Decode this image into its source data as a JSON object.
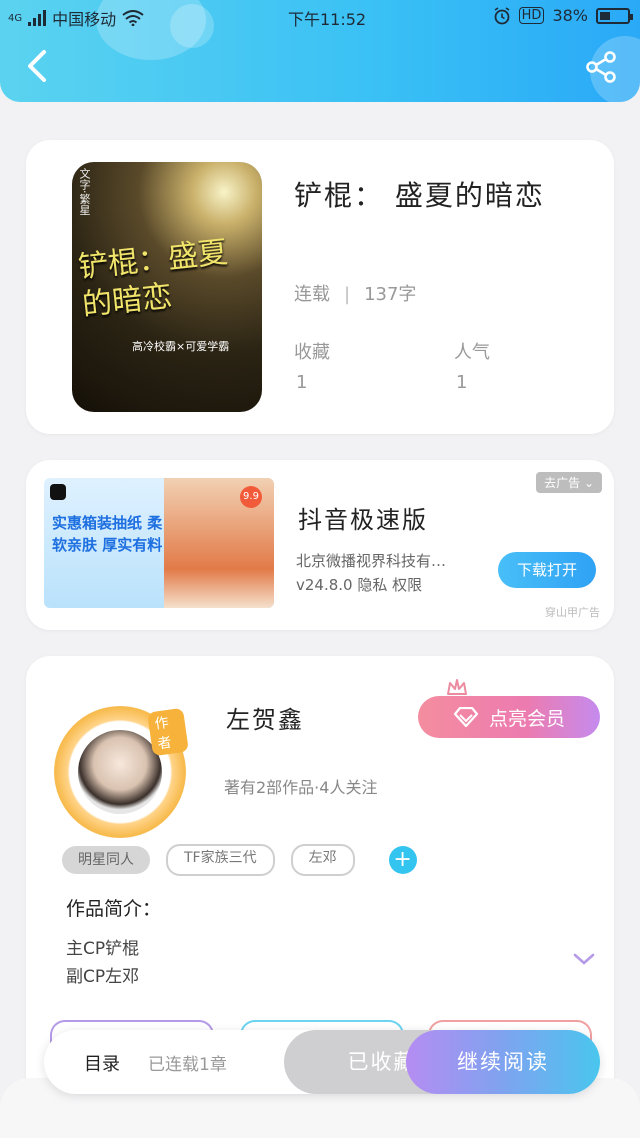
{
  "status_bar": {
    "network": "4G",
    "carrier": "中国移动",
    "time": "下午11:52",
    "volte": "HD",
    "battery": "38%"
  },
  "icons": {
    "back": "back-chevron-icon",
    "share": "share-icon",
    "wifi": "wifi-icon",
    "alarm": "alarm-icon",
    "expand": "chevron-down-icon",
    "diamond": "diamond-icon",
    "crown": "crown-icon",
    "add": "plus-icon"
  },
  "book": {
    "cover_title": "铲棍：盛夏的暗恋",
    "cover_subtitle": "高冷校霸×可爱学霸",
    "cover_side": "文字·繁星",
    "title": "铲棍： 盛夏的暗恋",
    "status": "连载",
    "word_count": "137字",
    "favorites_label": "收藏",
    "favorites_value": "1",
    "popularity_label": "人气",
    "popularity_value": "1"
  },
  "ad": {
    "image_banner": "实惠箱装抽纸 柔软亲肤 厚实有料",
    "image_badge": "9.9",
    "title": "抖音极速版",
    "company": "北京微播视界科技有…",
    "version_line": "v24.8.0 隐私 权限",
    "close_label": "去广告",
    "download_label": "下载打开",
    "source": "穿山甲广告"
  },
  "author": {
    "badge": "作者",
    "name": "左贺鑫",
    "stats": "著有2部作品·4人关注",
    "vip_button": "点亮会员",
    "tags": [
      "明星同人",
      "TF家族三代",
      "左邓"
    ],
    "intro_title": "作品简介：",
    "intro_lines": [
      "主CP铲棍",
      "副CP左邓"
    ]
  },
  "bottom_bar": {
    "toc_label": "目录",
    "toc_status": "已连载1章",
    "collected_button": "已收藏",
    "continue_button": "继续阅读"
  },
  "colors": {
    "header_start": "#5bd3f0",
    "header_end": "#2aa9f7",
    "accent_cyan": "#34c4f0",
    "vip_pink": "#ec7bb0",
    "continue_purple": "#b58cf2"
  }
}
